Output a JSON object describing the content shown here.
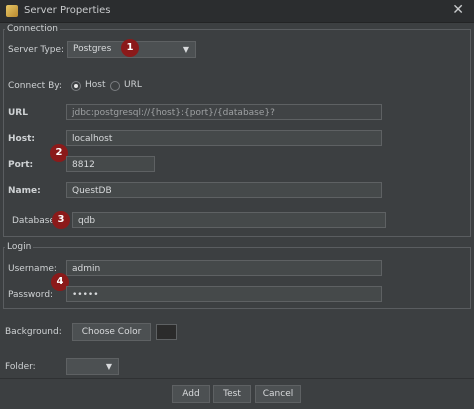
{
  "window": {
    "title": "Server Properties",
    "close_glyph": "✕",
    "icon": "app-icon"
  },
  "connection": {
    "group_title": "Connection",
    "server_type_label": "Server Type:",
    "server_type_value": "Postgres",
    "connect_by_label": "Connect By:",
    "connect_by_options": [
      "Host",
      "URL"
    ],
    "connect_by_selected": "Host",
    "url_label": "URL",
    "url_value": "jdbc:postgresql://{host}:{port}/{database}?",
    "host_label": "Host:",
    "host_value": "localhost",
    "port_label": "Port:",
    "port_value": "8812",
    "name_label": "Name:",
    "name_value": "QuestDB",
    "database_label": "Database:",
    "database_value": "qdb"
  },
  "login": {
    "group_title": "Login",
    "username_label": "Username:",
    "username_value": "admin",
    "password_label": "Password:",
    "password_value": "•••••"
  },
  "appearance": {
    "background_label": "Background:",
    "choose_color_label": "Choose Color",
    "swatch_color": "#2b2b2b",
    "folder_label": "Folder:",
    "folder_value": ""
  },
  "buttons": {
    "add": "Add",
    "test": "Test",
    "cancel": "Cancel"
  },
  "badges": [
    "1",
    "2",
    "3",
    "4"
  ],
  "colors": {
    "badge": "#8b1a1a",
    "background": "#3c3f41"
  }
}
